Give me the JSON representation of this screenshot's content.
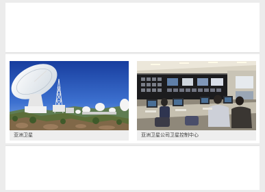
{
  "gallery": {
    "items": [
      {
        "caption": "亚洲卫星"
      },
      {
        "caption": "亚洲卫星公司卫星控制中心"
      }
    ]
  }
}
